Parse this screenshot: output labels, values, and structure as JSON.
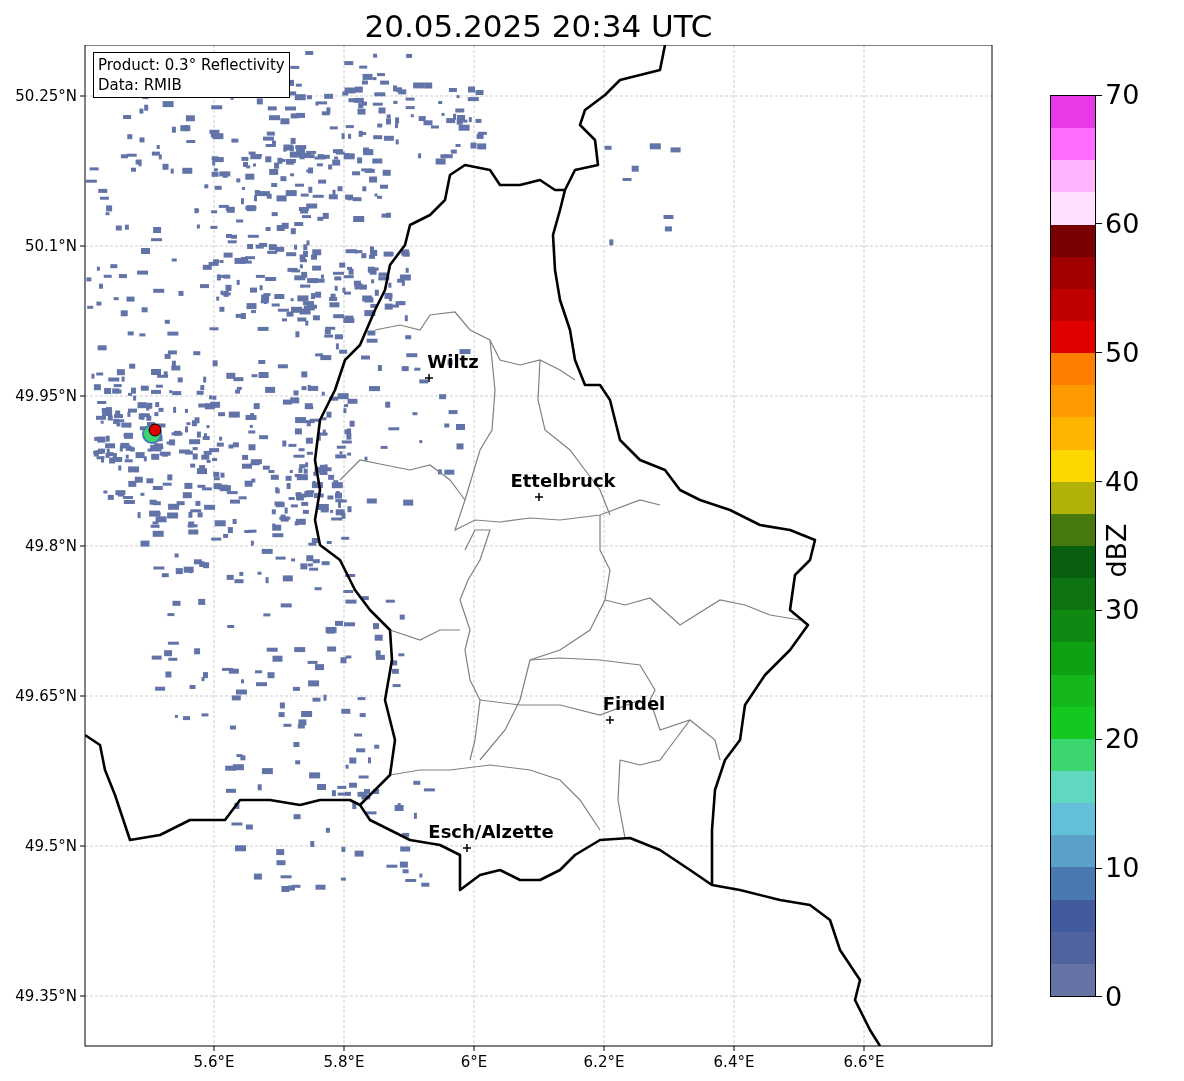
{
  "title": "20.05.2025 20:34 UTC",
  "info_box": [
    "Product: 0.3° Reflectivity",
    "Data: RMIB"
  ],
  "y_ticks": [
    "50.25°N",
    "50.1°N",
    "49.95°N",
    "49.8°N",
    "49.65°N",
    "49.5°N",
    "49.35°N"
  ],
  "x_ticks": [
    "5.6°E",
    "5.8°E",
    "6°E",
    "6.2°E",
    "6.4°E",
    "6.6°E"
  ],
  "cities": [
    {
      "name": "Wiltz"
    },
    {
      "name": "Ettelbruck"
    },
    {
      "name": "Findel"
    },
    {
      "name": "Esch/Alzette"
    }
  ],
  "colorbar": {
    "label": "dBZ",
    "ticks": [
      "70",
      "60",
      "50",
      "40",
      "30",
      "20",
      "10",
      "0"
    ],
    "bands": [
      {
        "color": "#e838e8"
      },
      {
        "color": "#ff6cff"
      },
      {
        "color": "#ffb4ff"
      },
      {
        "color": "#ffe0ff"
      },
      {
        "color": "#780000"
      },
      {
        "color": "#a00000"
      },
      {
        "color": "#c00000"
      },
      {
        "color": "#e00000"
      },
      {
        "color": "#ff7e00"
      },
      {
        "color": "#ff9a00"
      },
      {
        "color": "#ffb400"
      },
      {
        "color": "#ffd700"
      },
      {
        "color": "#b0b208"
      },
      {
        "color": "#467a0e"
      },
      {
        "color": "#08600e"
      },
      {
        "color": "#0e7412"
      },
      {
        "color": "#0e8a12"
      },
      {
        "color": "#10a014"
      },
      {
        "color": "#14b81c"
      },
      {
        "color": "#14c820"
      },
      {
        "color": "#3cd670"
      },
      {
        "color": "#60d8c0"
      },
      {
        "color": "#64c0d8"
      },
      {
        "color": "#5aa0c8"
      },
      {
        "color": "#4a78b0"
      },
      {
        "color": "#425b9f"
      },
      {
        "color": "#51639e"
      },
      {
        "color": "#6673a5"
      }
    ]
  }
}
